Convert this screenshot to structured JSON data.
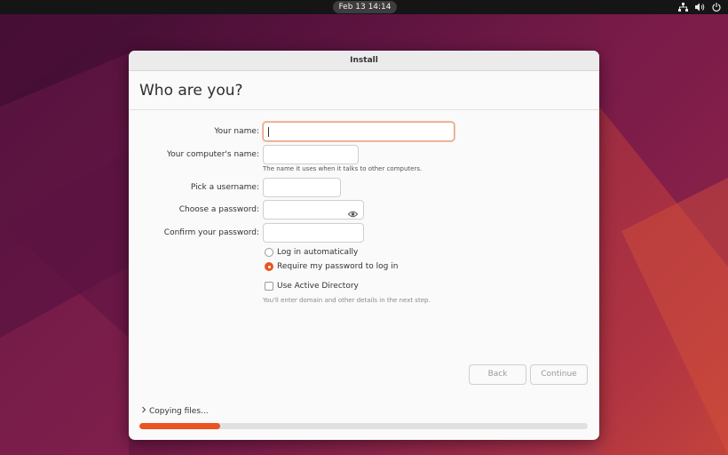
{
  "topbar": {
    "clock": "Feb 13  14:14"
  },
  "window": {
    "title": "Install"
  },
  "page": {
    "heading": "Who are you?"
  },
  "form": {
    "your_name_label": "Your name:",
    "your_name_value": "",
    "computer_name_label": "Your computer's name:",
    "computer_name_value": "",
    "computer_name_hint": "The name it uses when it talks to other computers.",
    "username_label": "Pick a username:",
    "username_value": "",
    "password_label": "Choose a password:",
    "confirm_password_label": "Confirm your password:"
  },
  "login_options": {
    "auto_login": {
      "label": "Log in automatically",
      "selected": false
    },
    "require_password": {
      "label": "Require my password to log in",
      "selected": true
    }
  },
  "active_directory": {
    "label": "Use Active Directory",
    "checked": false,
    "hint": "You'll enter domain and other details in the next step."
  },
  "buttons": {
    "back": "Back",
    "continue": "Continue"
  },
  "status": {
    "text": "Copying files...",
    "progress": 0.18
  },
  "colors": {
    "accent": "#E95420",
    "topbar": "#151515"
  },
  "icons": [
    "network-icon",
    "volume-icon",
    "power-icon",
    "eye-icon",
    "chevron-right-icon"
  ]
}
